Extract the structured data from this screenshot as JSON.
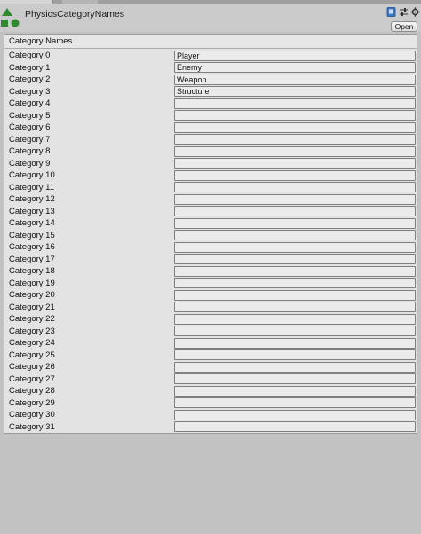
{
  "window": {
    "title": "PhysicsCategoryNames"
  },
  "header": {
    "icons": [
      "help-book-icon",
      "presets-sliders-icon",
      "settings-gear-icon"
    ],
    "open_label": "Open"
  },
  "section": {
    "title": "Category Names"
  },
  "categories": [
    {
      "label": "Category 0",
      "value": "Player"
    },
    {
      "label": "Category 1",
      "value": "Enemy"
    },
    {
      "label": "Category 2",
      "value": "Weapon"
    },
    {
      "label": "Category 3",
      "value": "Structure"
    },
    {
      "label": "Category 4",
      "value": ""
    },
    {
      "label": "Category 5",
      "value": ""
    },
    {
      "label": "Category 6",
      "value": ""
    },
    {
      "label": "Category 7",
      "value": ""
    },
    {
      "label": "Category 8",
      "value": ""
    },
    {
      "label": "Category 9",
      "value": ""
    },
    {
      "label": "Category 10",
      "value": ""
    },
    {
      "label": "Category 11",
      "value": ""
    },
    {
      "label": "Category 12",
      "value": ""
    },
    {
      "label": "Category 13",
      "value": ""
    },
    {
      "label": "Category 14",
      "value": ""
    },
    {
      "label": "Category 15",
      "value": ""
    },
    {
      "label": "Category 16",
      "value": ""
    },
    {
      "label": "Category 17",
      "value": ""
    },
    {
      "label": "Category 18",
      "value": ""
    },
    {
      "label": "Category 19",
      "value": ""
    },
    {
      "label": "Category 20",
      "value": ""
    },
    {
      "label": "Category 21",
      "value": ""
    },
    {
      "label": "Category 22",
      "value": ""
    },
    {
      "label": "Category 23",
      "value": ""
    },
    {
      "label": "Category 24",
      "value": ""
    },
    {
      "label": "Category 25",
      "value": ""
    },
    {
      "label": "Category 26",
      "value": ""
    },
    {
      "label": "Category 27",
      "value": ""
    },
    {
      "label": "Category 28",
      "value": ""
    },
    {
      "label": "Category 29",
      "value": ""
    },
    {
      "label": "Category 30",
      "value": ""
    },
    {
      "label": "Category 31",
      "value": ""
    }
  ],
  "colors": {
    "asset_icon": "#2f8a2f",
    "help_icon": "#3a78c8"
  }
}
